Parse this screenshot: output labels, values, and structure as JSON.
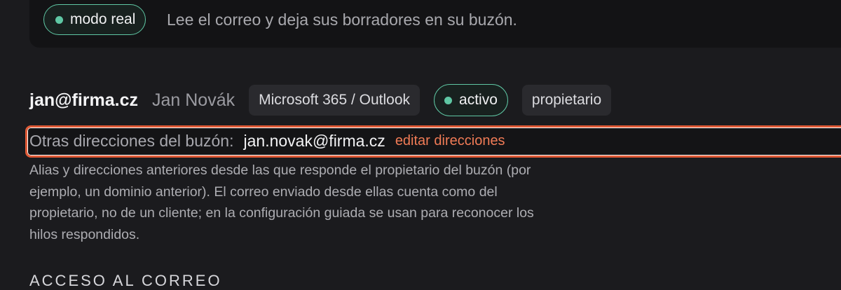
{
  "mode": {
    "label": "modo real"
  },
  "intro": "Lee el correo y deja sus borradores en su buzón.",
  "account": {
    "email": "jan@firma.cz",
    "name": "Jan Novák",
    "provider": "Microsoft 365 / Outlook",
    "status": "activo",
    "role": "propietario"
  },
  "aliases": {
    "label": "Otras direcciones del buzón:",
    "value": "jan.novak@firma.cz",
    "edit_label": "editar direcciones",
    "help": "Alias y direcciones anteriores desde las que responde el propietario del buzón (por ejemplo, un dominio anterior). El correo enviado desde ellas cuenta como del propietario, no de un cliente; en la configuración guiada se usan para reconocer los hilos respondidos."
  },
  "next_section": {
    "heading": "ACCESO AL CORREO"
  },
  "colors": {
    "accent_green": "#5fc7a4",
    "highlight_red": "#e05a36",
    "link": "#f07b56"
  }
}
